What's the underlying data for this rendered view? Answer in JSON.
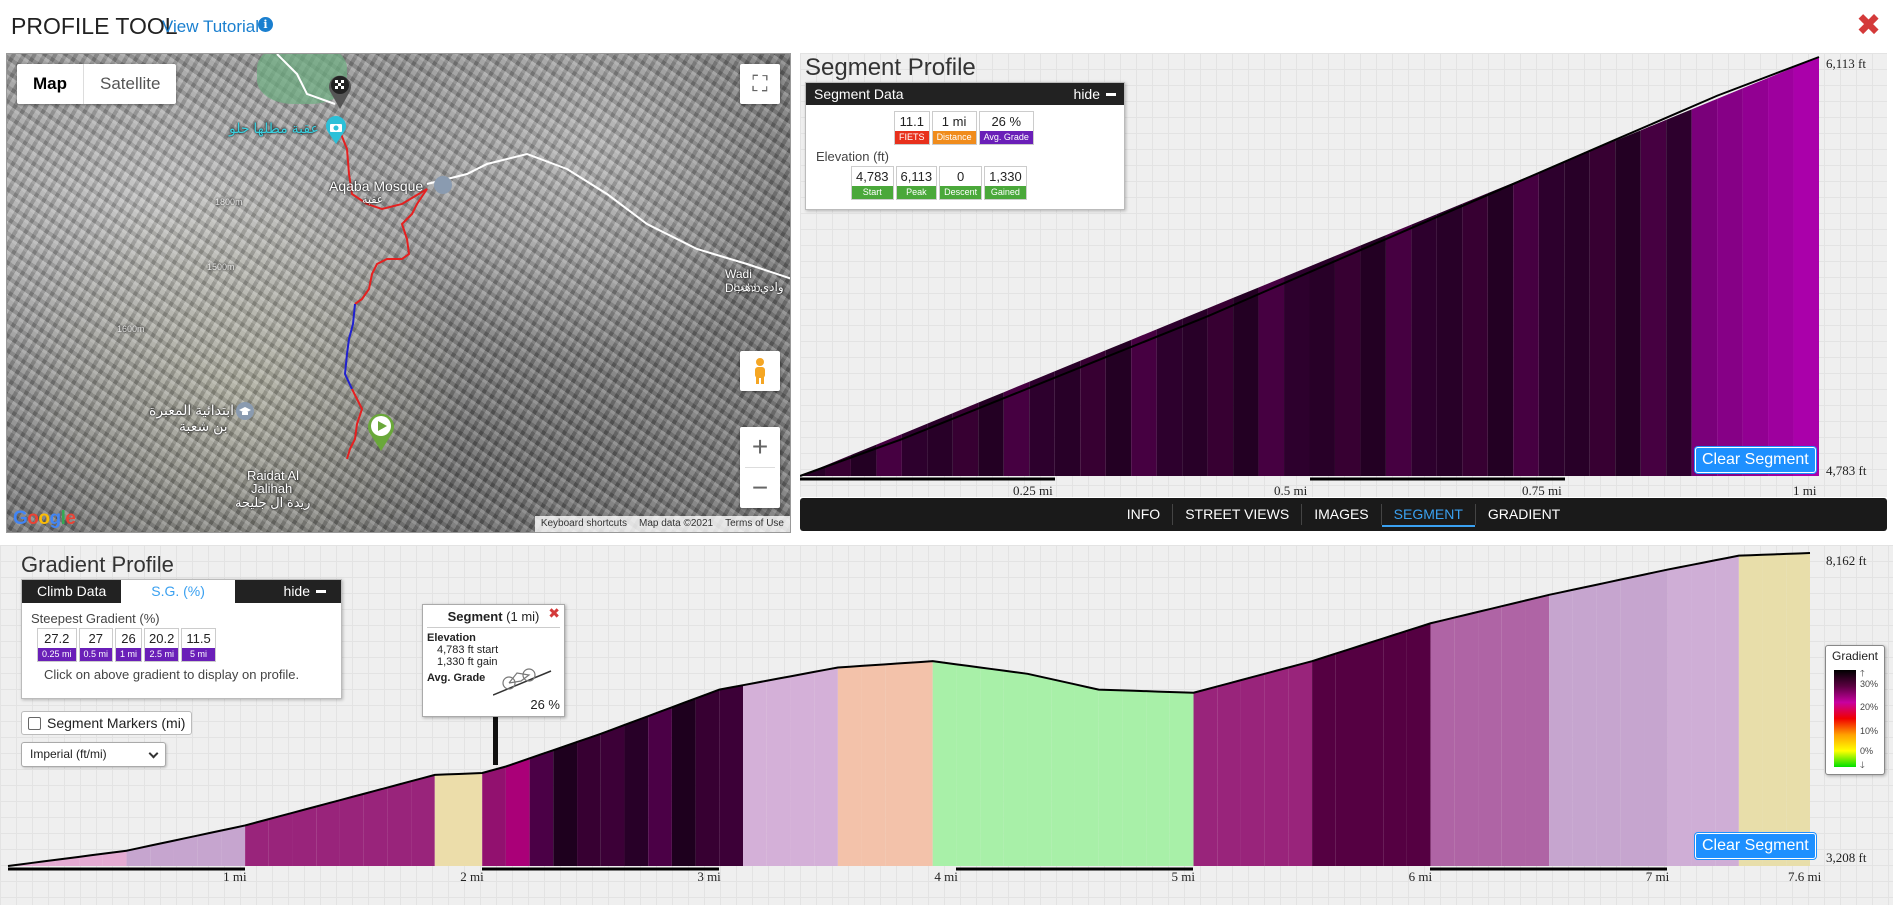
{
  "header": {
    "title": "PROFILE TOOL",
    "tutorial_link": "View Tutorial",
    "info_glyph": "i",
    "close_glyph": "✖"
  },
  "map": {
    "type_buttons": [
      "Map",
      "Satellite"
    ],
    "fullscreen_glyph": "⛶",
    "zoom_in": "+",
    "zoom_out": "−",
    "labels": {
      "place1": "عقبة مطلها حلو",
      "mosque": "Aqaba Mosque",
      "mosque_ar": "عقبة",
      "wadi": "Wadi Dhehb",
      "wadi_ar": "وادي دهب",
      "school_ar1": "ابتدائية المعبرة",
      "school_ar2": "بن شعبة",
      "raidat1": "Raidat Al",
      "raidat2": "Jalihah",
      "raidat_ar": "ريدة ال جليحة",
      "elev1": "1800m",
      "elev2": "1500m",
      "elev3": "1600m"
    },
    "footer": [
      "Keyboard shortcuts",
      "Map data ©2021",
      "Terms of Use"
    ],
    "logo": [
      "G",
      "o",
      "o",
      "g",
      "l",
      "e"
    ]
  },
  "segment_profile": {
    "title": "Segment Profile",
    "data_box": {
      "header": "Segment Data",
      "hide": "hide",
      "top_stats": [
        {
          "value": "11.1",
          "label": "FIETS",
          "color": "#e8301c"
        },
        {
          "value": "1 mi",
          "label": "Distance",
          "color": "#f08c1c"
        },
        {
          "value": "26 %",
          "label": "Avg. Grade",
          "color": "#6a1fb8"
        }
      ],
      "elevation_label": "Elevation (ft)",
      "elev_stats": [
        {
          "value": "4,783",
          "label": "Start",
          "color": "#4aa83a"
        },
        {
          "value": "6,113",
          "label": "Peak",
          "color": "#4aa83a"
        },
        {
          "value": "0",
          "label": "Descent",
          "color": "#4aa83a"
        },
        {
          "value": "1,330",
          "label": "Gained",
          "color": "#4aa83a"
        }
      ]
    },
    "y_top": "6,113 ft",
    "y_bottom": "4,783 ft",
    "x_ticks": [
      "0.25 mi",
      "0.5 mi",
      "0.75 mi",
      "1 mi"
    ],
    "clear_button": "Clear Segment"
  },
  "tabs": [
    {
      "label": "INFO",
      "active": false
    },
    {
      "label": "STREET VIEWS",
      "active": false
    },
    {
      "label": "IMAGES",
      "active": false
    },
    {
      "label": "SEGMENT",
      "active": true
    },
    {
      "label": "GRADIENT",
      "active": false
    }
  ],
  "gradient_profile": {
    "title": "Gradient Profile",
    "climb_box": {
      "tabs": [
        "Climb Data",
        "S.G. (%)"
      ],
      "hide": "hide",
      "steepest_label": "Steepest Gradient (%)",
      "stats": [
        {
          "value": "27.2",
          "label": "0.25 mi"
        },
        {
          "value": "27",
          "label": "0.5 mi"
        },
        {
          "value": "26",
          "label": "1 mi"
        },
        {
          "value": "20.2",
          "label": "2.5 mi"
        },
        {
          "value": "11.5",
          "label": "5 mi"
        }
      ],
      "hint": "Click on above gradient to display on profile."
    },
    "segment_markers_label": "Segment Markers (mi)",
    "units_select": "Imperial (ft/mi)",
    "tooltip": {
      "title_bold": "Segment",
      "title_rest": "(1 mi)",
      "close": "✖",
      "elevation": "Elevation",
      "start": "4,783 ft start",
      "gain": "1,330 ft gain",
      "avg_grade": "Avg. Grade",
      "grade_value": "26 %"
    },
    "legend": {
      "title": "Gradient",
      "ticks": [
        "30%",
        "20%",
        "10%",
        "0%"
      ],
      "up": "🡑",
      "down": "🡓"
    },
    "y_top": "8,162 ft",
    "y_bottom": "3,208 ft",
    "x_ticks": [
      "1 mi",
      "2 mi",
      "3 mi",
      "4 mi",
      "5 mi",
      "6 mi",
      "7 mi",
      "7.6 mi"
    ],
    "clear_button": "Clear Segment"
  },
  "chart_data": [
    {
      "type": "area",
      "xlabel": "",
      "ylabel": "",
      "x": [
        0,
        0.1,
        0.2,
        0.3,
        0.4,
        0.5,
        0.6,
        0.7,
        0.8,
        0.9,
        1.0
      ],
      "y": [
        4783,
        4900,
        5030,
        5160,
        5290,
        5430,
        5570,
        5710,
        5850,
        5990,
        6113
      ],
      "xlim": [
        0,
        1
      ],
      "ylim": [
        4783,
        6113
      ]
    },
    {
      "type": "area",
      "xlabel": "",
      "ylabel": "",
      "x": [
        0,
        0.5,
        1.0,
        1.5,
        1.8,
        2.0,
        2.1,
        2.5,
        3.0,
        3.5,
        3.9,
        4.3,
        4.6,
        5.0,
        5.5,
        6.0,
        6.5,
        7.0,
        7.3,
        7.6
      ],
      "y": [
        3208,
        3450,
        3850,
        4350,
        4650,
        4680,
        4783,
        5300,
        6000,
        6350,
        6450,
        6250,
        6000,
        5950,
        6450,
        7050,
        7500,
        7900,
        8120,
        8162
      ],
      "segment": [
        2.1,
        3.1
      ],
      "xlim": [
        0,
        7.6
      ],
      "ylim": [
        3208,
        8162
      ]
    }
  ]
}
